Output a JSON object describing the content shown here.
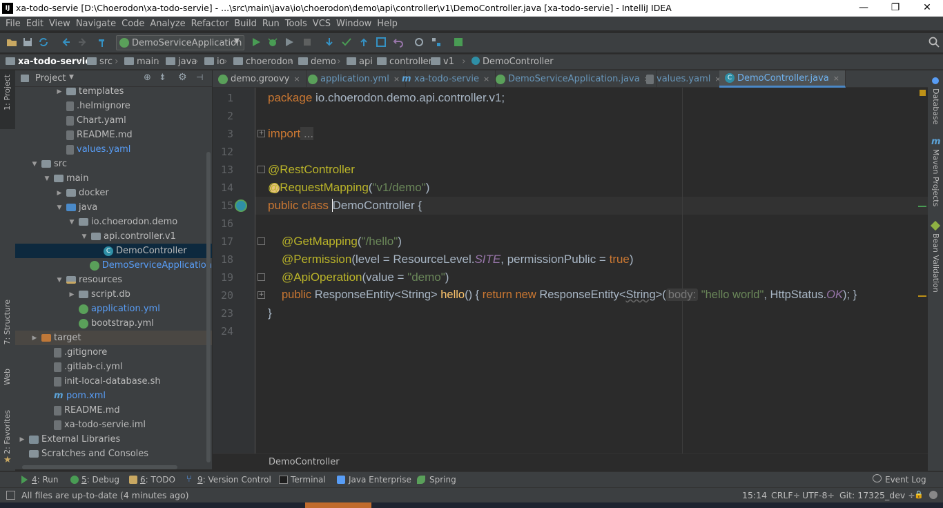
{
  "window": {
    "title": "xa-todo-servie [D:\\Choerodon\\xa-todo-servie] - ...\\src\\main\\java\\io\\choerodon\\demo\\api\\controller\\v1\\DemoController.java [xa-todo-servie] - IntelliJ IDEA",
    "app_icon": "IJ",
    "minimize": "—",
    "maximize": "❐",
    "close": "✕"
  },
  "menu": [
    "File",
    "Edit",
    "View",
    "Navigate",
    "Code",
    "Analyze",
    "Refactor",
    "Build",
    "Run",
    "Tools",
    "VCS",
    "Window",
    "Help"
  ],
  "run_config": "DemoServiceApplication",
  "breadcrumb": [
    "xa-todo-servie",
    "src",
    "main",
    "java",
    "io",
    "choerodon",
    "demo",
    "api",
    "controller",
    "v1",
    "DemoController"
  ],
  "project_panel": {
    "title": "Project"
  },
  "tree": [
    {
      "label": "templates",
      "depth": 3,
      "arrow": "▶",
      "icon": "fold"
    },
    {
      "label": ".helmignore",
      "depth": 3,
      "arrow": "",
      "icon": "file"
    },
    {
      "label": "Chart.yaml",
      "depth": 3,
      "arrow": "",
      "icon": "file"
    },
    {
      "label": "README.md",
      "depth": 3,
      "arrow": "",
      "icon": "file"
    },
    {
      "label": "values.yaml",
      "depth": 3,
      "arrow": "",
      "icon": "file",
      "blue": true
    },
    {
      "label": "src",
      "depth": 1,
      "arrow": "▼",
      "icon": "fold"
    },
    {
      "label": "main",
      "depth": 2,
      "arrow": "▼",
      "icon": "fold"
    },
    {
      "label": "docker",
      "depth": 3,
      "arrow": "▶",
      "icon": "fold"
    },
    {
      "label": "java",
      "depth": 3,
      "arrow": "▼",
      "icon": "src"
    },
    {
      "label": "io.choerodon.demo",
      "depth": 4,
      "arrow": "▼",
      "icon": "fold"
    },
    {
      "label": "api.controller.v1",
      "depth": 5,
      "arrow": "▼",
      "icon": "fold"
    },
    {
      "label": "DemoController",
      "depth": 6,
      "arrow": "",
      "icon": "cls",
      "selected": true
    },
    {
      "label": "DemoServiceApplication",
      "depth": 5,
      "arrow": "",
      "icon": "spr",
      "blue": true
    },
    {
      "label": "resources",
      "depth": 3,
      "arrow": "▼",
      "icon": "res"
    },
    {
      "label": "script.db",
      "depth": 4,
      "arrow": "▶",
      "icon": "fold"
    },
    {
      "label": "application.yml",
      "depth": 4,
      "arrow": "",
      "icon": "spr",
      "blue": true
    },
    {
      "label": "bootstrap.yml",
      "depth": 4,
      "arrow": "",
      "icon": "spr"
    },
    {
      "label": "target",
      "depth": 1,
      "arrow": "▶",
      "icon": "tgt",
      "highlight": true
    },
    {
      "label": ".gitignore",
      "depth": 2,
      "arrow": "",
      "icon": "file"
    },
    {
      "label": ".gitlab-ci.yml",
      "depth": 2,
      "arrow": "",
      "icon": "file"
    },
    {
      "label": "init-local-database.sh",
      "depth": 2,
      "arrow": "",
      "icon": "file"
    },
    {
      "label": "pom.xml",
      "depth": 2,
      "arrow": "",
      "icon": "m",
      "blue": true
    },
    {
      "label": "README.md",
      "depth": 2,
      "arrow": "",
      "icon": "file"
    },
    {
      "label": "xa-todo-servie.iml",
      "depth": 2,
      "arrow": "",
      "icon": "file"
    },
    {
      "label": "External Libraries",
      "depth": 0,
      "arrow": "▶",
      "icon": "lib"
    },
    {
      "label": "Scratches and Consoles",
      "depth": 0,
      "arrow": "",
      "icon": "fold"
    }
  ],
  "tabs": [
    {
      "label": "demo.groovy",
      "icon": "spr",
      "active": false
    },
    {
      "label": "application.yml",
      "icon": "spr",
      "active": false,
      "blue": true
    },
    {
      "label": "xa-todo-servie",
      "icon": "m",
      "active": false,
      "blue": true
    },
    {
      "label": "DemoServiceApplication.java",
      "icon": "spr",
      "active": false,
      "blue": true
    },
    {
      "label": "values.yaml",
      "icon": "file",
      "active": false,
      "blue": true
    },
    {
      "label": "DemoController.java",
      "icon": "cls",
      "active": true,
      "blue": true
    }
  ],
  "line_numbers": [
    "1",
    "2",
    "3",
    "12",
    "13",
    "14",
    "15",
    "16",
    "17",
    "18",
    "19",
    "20",
    "23",
    "24"
  ],
  "code": {
    "l1_kw": "package",
    "l1_rest": " io.choerodon.demo.api.controller.v1;",
    "l3_kw": "import",
    "l3_fold": " ...",
    "l13": "@RestController",
    "l14_ann": "@RequestMapping",
    "l14_p1": "(",
    "l14_str": "\"v1/demo\"",
    "l14_p2": ")",
    "l15_kw": "public class ",
    "l15_cls": "DemoController",
    "l15_rest": " {",
    "l17_ann": "@GetMapping",
    "l17_p1": "(",
    "l17_str": "\"/hello\"",
    "l17_p2": ")",
    "l18_ann": "@Permission",
    "l18_a": "(level = ResourceLevel.",
    "l18_it": "SITE",
    "l18_b": ", permissionPublic = ",
    "l18_kw": "true",
    "l18_c": ")",
    "l19_ann": "@ApiOperation",
    "l19_a": "(value = ",
    "l19_str": "\"demo\"",
    "l19_c": ")",
    "l20_kw": "public",
    "l20_a": " ResponseEntity<String> ",
    "l20_fn": "hello",
    "l20_b": "() { ",
    "l20_kw2": "return new",
    "l20_c": " ResponseEntity<",
    "l20_d": "String",
    "l20_e": ">(",
    "l20_hint": "body:",
    "l20_str": " \"hello world\"",
    "l20_f": ", HttpStatus.",
    "l20_it": "OK",
    "l20_g": "); }",
    "l23": "}"
  },
  "editor_footer": "DemoController",
  "left_stripe": [
    "1: Project",
    "7: Structure",
    "Web",
    "2: Favorites"
  ],
  "right_stripe": [
    "Database",
    "Maven Projects",
    "Bean Validation"
  ],
  "bottom_tabs": [
    {
      "num": "4",
      "label": ": Run"
    },
    {
      "num": "5",
      "label": ": Debug"
    },
    {
      "num": "6",
      "label": ": TODO"
    },
    {
      "num": "9",
      "label": ": Version Control"
    },
    {
      "num": "",
      "label": "Terminal"
    },
    {
      "num": "",
      "label": "Java Enterprise"
    },
    {
      "num": "",
      "label": "Spring"
    }
  ],
  "event_log": "Event Log",
  "status": {
    "message": "All files are up-to-date (4 minutes ago)",
    "position": "15:14",
    "line_sep": "CRLF÷",
    "encoding": "UTF-8÷",
    "git": "Git: 17325_dev ÷"
  },
  "colors": {
    "accent": "#4a88c7",
    "selected_row": "#0d293e",
    "editor_bg": "#2b2b2b",
    "panel_bg": "#3c3f41"
  }
}
